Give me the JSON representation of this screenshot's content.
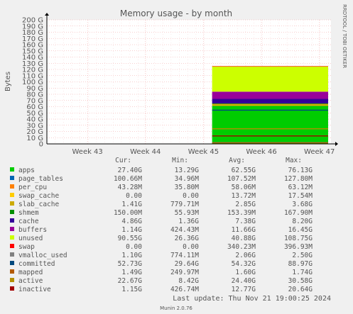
{
  "chart_data": {
    "type": "area",
    "title": "Memory usage - by month",
    "ylabel": "Bytes",
    "side_label": "RRDTOOL / TOBI OETIKER",
    "y_ticks": [
      "0",
      "10 G",
      "20 G",
      "30 G",
      "40 G",
      "50 G",
      "60 G",
      "70 G",
      "80 G",
      "90 G",
      "100 G",
      "110 G",
      "120 G",
      "130 G",
      "140 G",
      "150 G",
      "160 G",
      "170 G",
      "180 G",
      "190 G",
      "200 G"
    ],
    "ylim": [
      0,
      200
    ],
    "y_unit": "G",
    "x_ticks": [
      "Week 43",
      "Week 44",
      "Week 45",
      "Week 46",
      "Week 47"
    ],
    "x_range_weeks": [
      42.3,
      47.2
    ],
    "data_start_week": 45.15,
    "grid": true,
    "legend_headers": [
      "Cur:",
      "Min:",
      "Avg:",
      "Max:"
    ],
    "series": [
      {
        "name": "apps",
        "color": "#00cc00",
        "cur": "27.40G",
        "min": "13.29G",
        "avg": "62.55G",
        "max": "76.13G",
        "level": 62
      },
      {
        "name": "page_tables",
        "color": "#0066b3",
        "cur": "100.66M",
        "min": "34.96M",
        "avg": "107.52M",
        "max": "127.80M",
        "level": 0.1
      },
      {
        "name": "per_cpu",
        "color": "#ff8000",
        "cur": "43.28M",
        "min": "35.80M",
        "avg": "58.06M",
        "max": "63.12M",
        "level": 0.06
      },
      {
        "name": "swap_cache",
        "color": "#ffcc00",
        "cur": "0.00",
        "min": "0.00",
        "avg": "13.72M",
        "max": "17.54M",
        "level": 0.01
      },
      {
        "name": "slab_cache",
        "color": "#ccaa00",
        "cur": "1.41G",
        "min": "779.71M",
        "avg": "2.85G",
        "max": "3.68G",
        "level": 2.85
      },
      {
        "name": "shmem",
        "color": "#008f00",
        "cur": "150.00M",
        "min": "55.93M",
        "avg": "153.39M",
        "max": "167.90M",
        "level": 0.15
      },
      {
        "name": "cache",
        "color": "#330099",
        "cur": "4.86G",
        "min": "1.36G",
        "avg": "7.38G",
        "max": "8.20G",
        "level": 7.38
      },
      {
        "name": "buffers",
        "color": "#990099",
        "cur": "1.14G",
        "min": "424.43M",
        "avg": "11.66G",
        "max": "16.45G",
        "level": 11.66
      },
      {
        "name": "unused",
        "color": "#ccff00",
        "cur": "90.55G",
        "min": "26.36G",
        "avg": "40.88G",
        "max": "108.75G",
        "level": 40.88
      },
      {
        "name": "swap",
        "color": "#ff0000",
        "cur": "0.00",
        "min": "0.00",
        "avg": "340.23M",
        "max": "396.93M",
        "level": 0.34
      },
      {
        "name": "vmalloc_used",
        "color": "#808080",
        "cur": "1.10G",
        "min": "774.11M",
        "avg": "2.06G",
        "max": "2.50G"
      },
      {
        "name": "committed",
        "color": "#00487d",
        "cur": "52.73G",
        "min": "29.64G",
        "avg": "54.32G",
        "max": "88.97G"
      },
      {
        "name": "mapped",
        "color": "#b35a00",
        "cur": "1.49G",
        "min": "249.97M",
        "avg": "1.60G",
        "max": "1.74G"
      },
      {
        "name": "active",
        "color": "#b38f00",
        "cur": "22.67G",
        "min": "8.42G",
        "avg": "24.40G",
        "max": "30.58G"
      },
      {
        "name": "inactive",
        "color": "#a30000",
        "cur": "1.15G",
        "min": "426.74M",
        "avg": "12.77G",
        "max": "20.64G"
      }
    ]
  },
  "footer": {
    "last_update": "Last update: Thu Nov 21 19:00:25 2024",
    "version": "Munin 2.0.76"
  }
}
